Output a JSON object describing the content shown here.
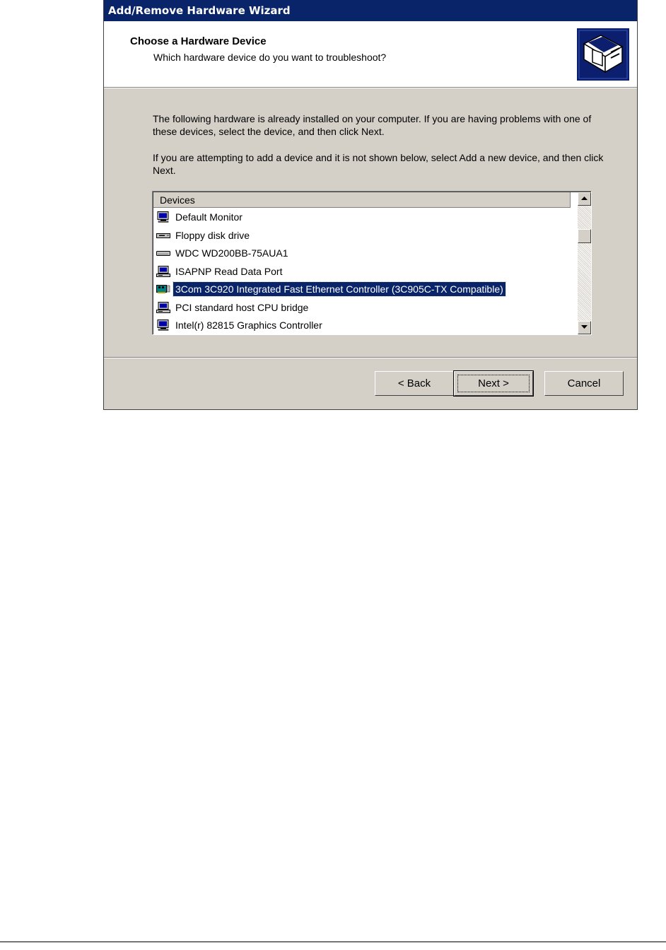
{
  "window": {
    "title": "Add/Remove Hardware Wizard"
  },
  "header": {
    "title": "Choose a Hardware Device",
    "subtitle": "Which hardware device do you want to troubleshoot?",
    "icon": "hardware-wizard-icon"
  },
  "body": {
    "paragraph1": "The following hardware is already installed on your computer. If you are having problems with one of these devices, select the device, and then click Next.",
    "paragraph2": "If you are attempting to add a device and it is not shown below, select Add a new device, and then click Next."
  },
  "list": {
    "column_header": "Devices",
    "items": [
      {
        "label": "Default Monitor",
        "icon": "monitor-icon",
        "selected": false
      },
      {
        "label": "Floppy disk drive",
        "icon": "floppy-drive-icon",
        "selected": false
      },
      {
        "label": "WDC WD200BB-75AUA1",
        "icon": "hard-disk-icon",
        "selected": false
      },
      {
        "label": "ISAPNP Read Data Port",
        "icon": "computer-icon",
        "selected": false
      },
      {
        "label": "3Com 3C920 Integrated Fast Ethernet Controller (3C905C-TX Compatible)",
        "icon": "network-card-icon",
        "selected": true
      },
      {
        "label": "PCI standard host CPU bridge",
        "icon": "computer-icon",
        "selected": false
      },
      {
        "label": "Intel(r) 82815 Graphics Controller",
        "icon": "monitor-icon",
        "selected": false
      }
    ]
  },
  "buttons": {
    "back": "< Back",
    "next": "Next >",
    "cancel": "Cancel"
  },
  "colors": {
    "titlebar": "#0a246a",
    "face": "#d4d0c8",
    "selection": "#0a246a"
  }
}
